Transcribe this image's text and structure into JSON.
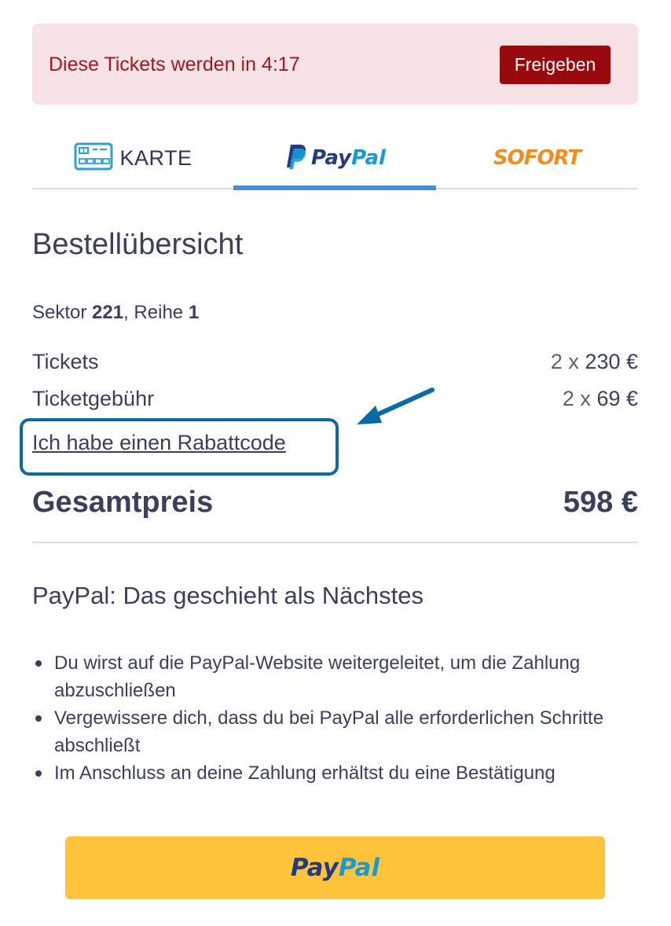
{
  "timer_banner": {
    "message": "Diese Tickets werden in 4:17",
    "release_label": "Freigeben"
  },
  "payment_tabs": {
    "card_label": "KARTE",
    "paypal_part1": "Pay",
    "paypal_part2": "Pal",
    "sofort_label": "SOFORT",
    "active": "paypal",
    "card_icon": "credit-card-icon",
    "paypal_icon": "paypal-logo-icon"
  },
  "order_summary": {
    "title": "Bestellübersicht",
    "sector_prefix": "Sektor",
    "sector": "221",
    "row_prefix": ", Reihe",
    "row": "1",
    "tickets_label": "Tickets",
    "tickets_qty": "2 x",
    "tickets_price": "230 €",
    "fee_label": "Ticketgebühr",
    "fee_qty": "2 x",
    "fee_price": "69 €",
    "promo_link": "Ich habe einen Rabattcode",
    "total_label": "Gesamtpreis",
    "total_value": "598 €"
  },
  "next_steps": {
    "title": "PayPal: Das geschieht als Nächstes",
    "items": [
      "Du wirst auf die PayPal-Website weitergeleitet, um die Zahlung abzuschließen",
      "Vergewissere dich, dass du bei PayPal alle erforderlichen Schritte abschließt",
      "Im Anschluss an deine Zahlung erhältst du eine Bestätigung"
    ]
  },
  "pay_button": {
    "part1": "Pay",
    "part2": "Pal"
  },
  "colors": {
    "banner_bg": "#f7e3e5",
    "banner_text": "#a3171d",
    "release_button": "#990a0f",
    "active_tab": "#4a8bdc",
    "highlight_box": "#0a6aa3",
    "paypal_button": "#ffc43b",
    "paypal_dark": "#253b80",
    "paypal_light": "#179bd7",
    "sofort_orange": "#f38b1f"
  }
}
